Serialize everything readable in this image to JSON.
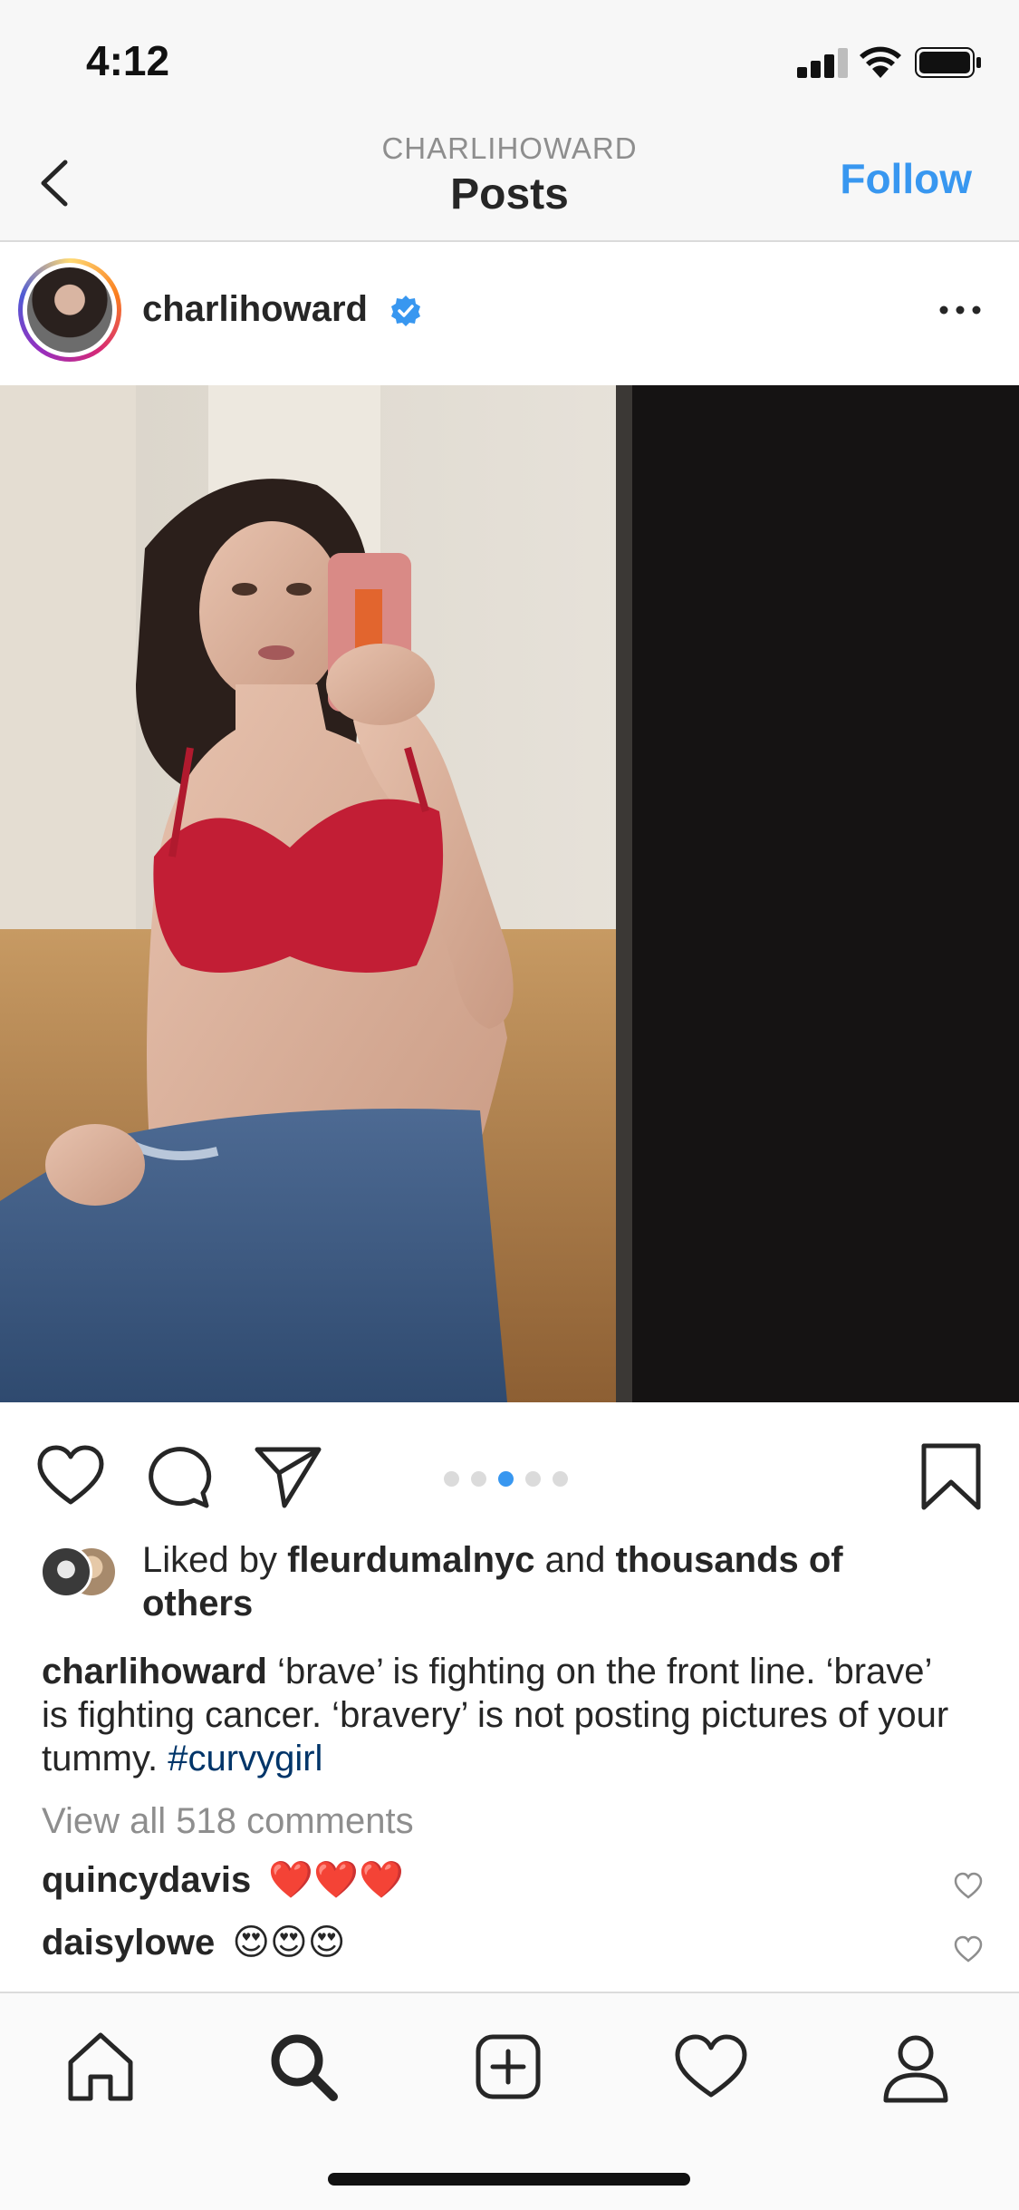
{
  "status_bar": {
    "time": "4:12"
  },
  "header": {
    "account_label": "CHARLIHOWARD",
    "title": "Posts",
    "follow_label": "Follow"
  },
  "post": {
    "username": "charlihoward",
    "carousel": {
      "count": 5,
      "active_index": 2
    },
    "likes": {
      "prefix": "Liked by",
      "liker": "fleurdumalnyc",
      "connector": "and",
      "suffix": "thousands of others"
    },
    "caption": {
      "username": "charlihoward",
      "text": "‘brave’ is fighting on the front line. ‘brave’ is fighting cancer. ‘bravery’ is not posting pictures of your tummy.",
      "hashtag": "#curvygirl"
    },
    "view_comments": "View all 518 comments",
    "comments": [
      {
        "username": "quincydavis",
        "text": "❤️❤️❤️"
      },
      {
        "username": "daisylowe",
        "text": "😍😍😍"
      }
    ]
  },
  "colors": {
    "link_blue": "#3897f0",
    "hashtag_blue": "#003569",
    "verified": "#3897f0"
  },
  "icons": [
    "back-icon",
    "verified-icon",
    "more-icon",
    "heart-icon",
    "comment-icon",
    "share-icon",
    "bookmark-icon",
    "home-icon",
    "search-icon",
    "new-post-icon",
    "activity-icon",
    "profile-icon"
  ]
}
